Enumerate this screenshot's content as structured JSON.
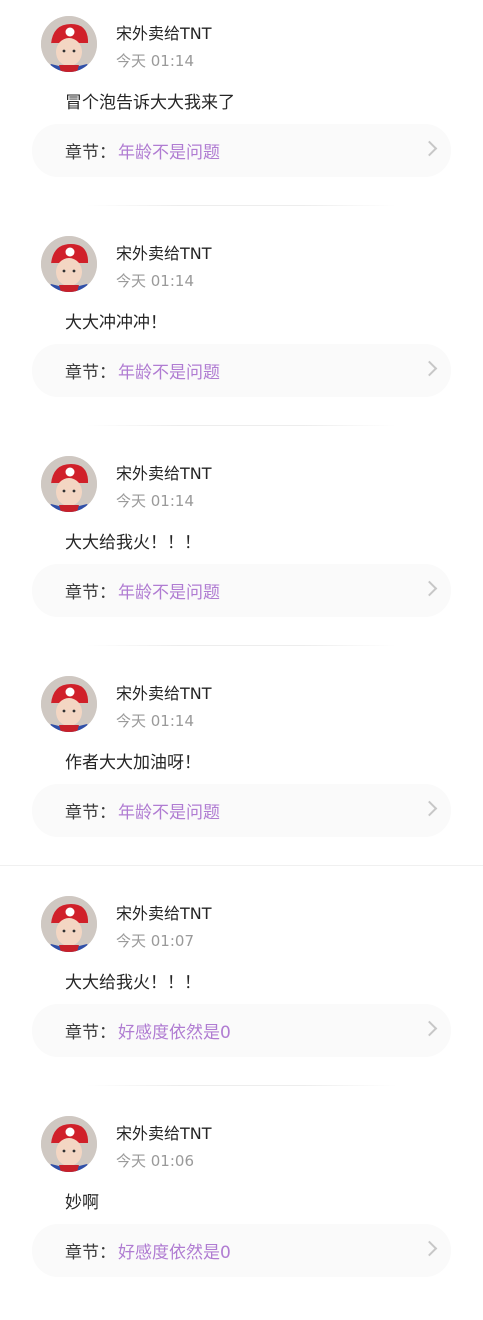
{
  "chapter_prefix": "章节：",
  "comments": [
    {
      "user": "宋外卖给TNT",
      "time": "今天 01:14",
      "text": "冒个泡告诉大大我来了",
      "chapter": "年龄不是问题"
    },
    {
      "user": "宋外卖给TNT",
      "time": "今天 01:14",
      "text": "大大冲冲冲！",
      "chapter": "年龄不是问题"
    },
    {
      "user": "宋外卖给TNT",
      "time": "今天 01:14",
      "text": "大大给我火！！！",
      "chapter": "年龄不是问题"
    },
    {
      "user": "宋外卖给TNT",
      "time": "今天 01:14",
      "text": "作者大大加油呀！",
      "chapter": "年龄不是问题"
    },
    {
      "user": "宋外卖给TNT",
      "time": "今天 01:07",
      "text": "大大给我火！！！",
      "chapter": "好感度依然是0"
    },
    {
      "user": "宋外卖给TNT",
      "time": "今天 01:06",
      "text": "妙啊",
      "chapter": "好感度依然是0"
    }
  ],
  "colors": {
    "chapter_title": "#b07cd2",
    "time": "#9a9a9a",
    "chapter_bg": "#fafafa"
  },
  "icons": {
    "avatar": "user-avatar",
    "chevron": "chevron-right-icon"
  }
}
